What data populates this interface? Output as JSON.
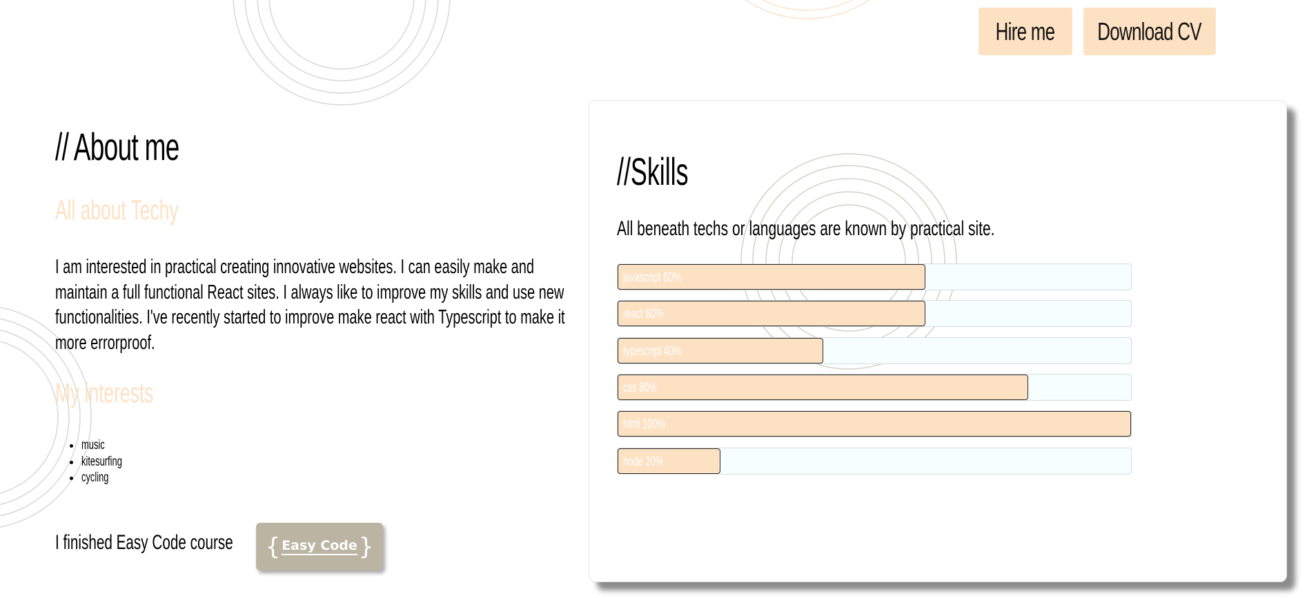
{
  "header": {
    "hire_label": "Hire me",
    "cv_label": "Download CV"
  },
  "about": {
    "title": "// About me",
    "subtitle": "All about Techy",
    "text": "I am interested in practical creating innovative websites. I can easily make and maintain a full functional React sites. I always like to improve my skills and use new functionalities. I've recently started to improve make react with Typescript to make it more errorproof.",
    "interests_title": "My interests",
    "interests": [
      "music",
      "kitesurfing",
      "cycling"
    ],
    "course_text": "I finished Easy Code course",
    "course_badge": "Easy Code"
  },
  "skills": {
    "title": "//Skills",
    "description": "All beneath techs or languages are known by practical site.",
    "items": [
      {
        "label": "javascript 60%",
        "percent": 60
      },
      {
        "label": "react 60%",
        "percent": 60
      },
      {
        "label": "typescript 40%",
        "percent": 40
      },
      {
        "label": "css 80%",
        "percent": 80
      },
      {
        "label": "html 100%",
        "percent": 100
      },
      {
        "label": "node 20%",
        "percent": 20
      }
    ]
  },
  "colors": {
    "accent": "#fde1c3",
    "track": "#f6fefe",
    "badge": "#bcb4a2"
  },
  "icons": {
    "badge_left": "left-brace-icon",
    "badge_right": "right-brace-icon"
  }
}
